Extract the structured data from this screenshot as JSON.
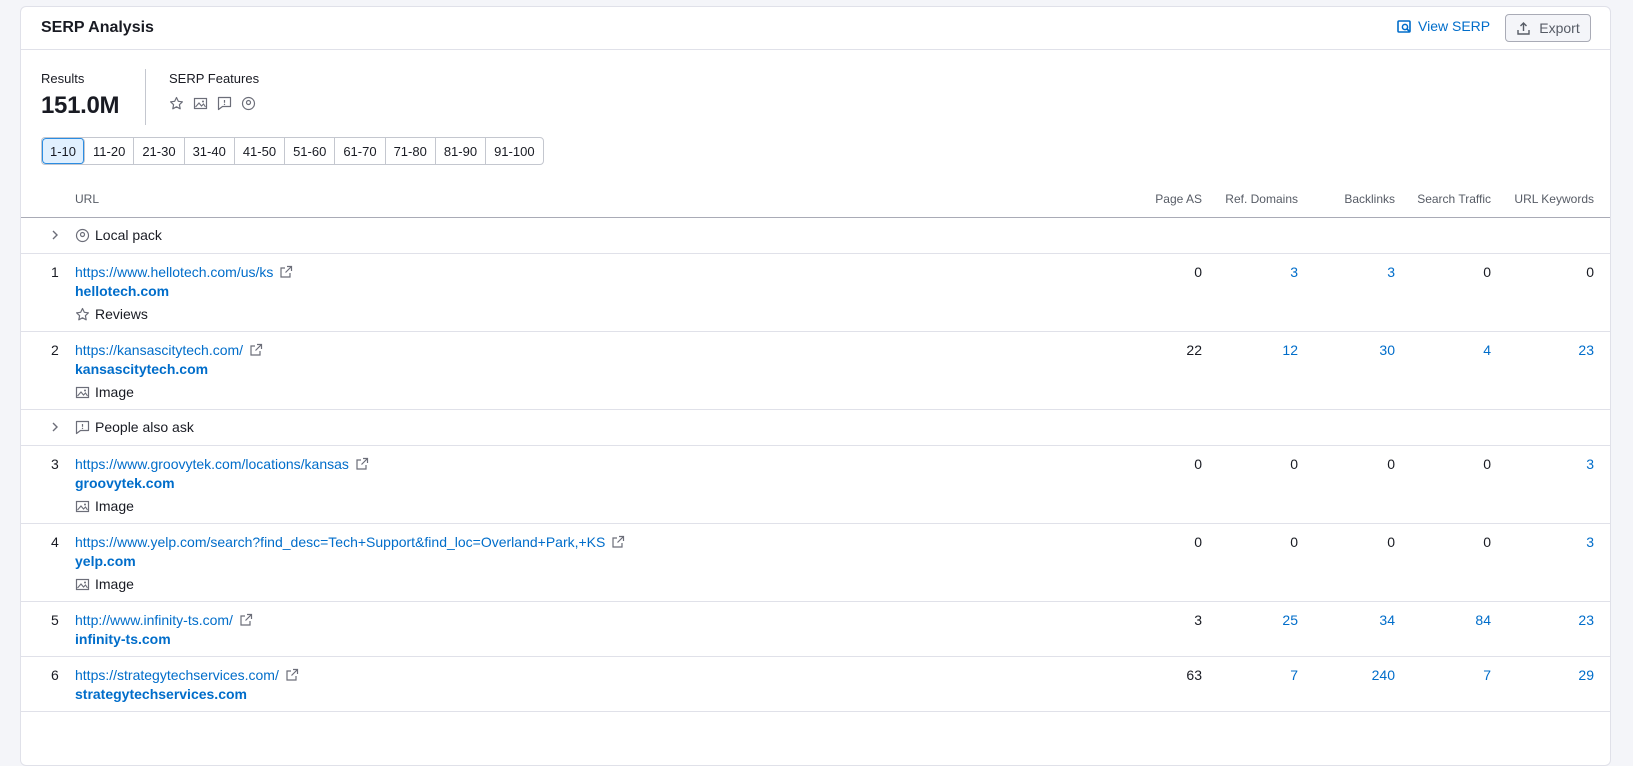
{
  "header": {
    "title": "SERP Analysis",
    "view_serp_label": "View SERP",
    "export_label": "Export"
  },
  "summary": {
    "results_label": "Results",
    "results_value": "151.0M",
    "serp_features_label": "SERP Features",
    "feature_icons": [
      "star-icon",
      "image-icon",
      "speech-bubble-icon",
      "location-pin-icon"
    ]
  },
  "pager": {
    "pages": [
      "1-10",
      "11-20",
      "21-30",
      "31-40",
      "41-50",
      "51-60",
      "61-70",
      "71-80",
      "81-90",
      "91-100"
    ],
    "active": "1-10"
  },
  "table": {
    "columns": {
      "url": "URL",
      "page_as": "Page AS",
      "ref_domains": "Ref. Domains",
      "backlinks": "Backlinks",
      "search_traffic": "Search Traffic",
      "url_keywords": "URL Keywords"
    },
    "feature_rows": [
      {
        "label": "Local pack",
        "icon": "location-pin-icon"
      },
      {
        "label": "People also ask",
        "icon": "speech-bubble-icon"
      }
    ],
    "rows": [
      {
        "rank": "1",
        "url": "https://www.hellotech.com/us/ks",
        "domain": "hellotech.com",
        "feature": "Reviews",
        "feature_icon": "star-icon",
        "page_as": "0",
        "ref_domains": "3",
        "backlinks": "3",
        "search_traffic": "0",
        "url_keywords": "0"
      },
      {
        "rank": "2",
        "url": "https://kansascitytech.com/",
        "domain": "kansascitytech.com",
        "feature": "Image",
        "feature_icon": "image-icon",
        "page_as": "22",
        "ref_domains": "12",
        "backlinks": "30",
        "search_traffic": "4",
        "url_keywords": "23"
      },
      {
        "rank": "3",
        "url": "https://www.groovytek.com/locations/kansas",
        "domain": "groovytek.com",
        "feature": "Image",
        "feature_icon": "image-icon",
        "page_as": "0",
        "ref_domains": "0",
        "backlinks": "0",
        "search_traffic": "0",
        "url_keywords": "3"
      },
      {
        "rank": "4",
        "url": "https://www.yelp.com/search?find_desc=Tech+Support&find_loc=Overland+Park,+KS",
        "domain": "yelp.com",
        "feature": "Image",
        "feature_icon": "image-icon",
        "page_as": "0",
        "ref_domains": "0",
        "backlinks": "0",
        "search_traffic": "0",
        "url_keywords": "3"
      },
      {
        "rank": "5",
        "url": "http://www.infinity-ts.com/",
        "domain": "infinity-ts.com",
        "feature": "",
        "feature_icon": "",
        "page_as": "3",
        "ref_domains": "25",
        "backlinks": "34",
        "search_traffic": "84",
        "url_keywords": "23"
      },
      {
        "rank": "6",
        "url": "https://strategytechservices.com/",
        "domain": "strategytechservices.com",
        "feature": "",
        "feature_icon": "",
        "page_as": "63",
        "ref_domains": "7",
        "backlinks": "240",
        "search_traffic": "7",
        "url_keywords": "29"
      }
    ]
  },
  "colors": {
    "link": "#006dca",
    "text": "#191b23",
    "muted": "#575c66",
    "border": "#e0e1e9",
    "active_page_bg": "#e1f0fe"
  }
}
